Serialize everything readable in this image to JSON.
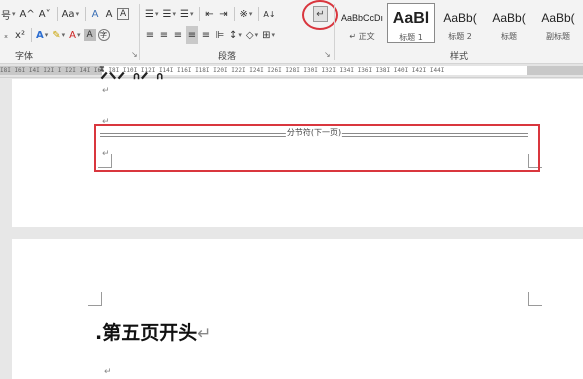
{
  "ribbon": {
    "font_row1": [
      "号",
      "A^",
      "A˅",
      "Aa",
      "A",
      "A"
    ],
    "font_row2": [
      "x²",
      "A",
      "ab",
      "A",
      "A",
      "字"
    ],
    "para_row1": [
      "≡",
      "≡",
      "≡",
      "≡",
      "≡",
      "A"
    ],
    "para_row2": [
      "≡",
      "≡",
      "≡",
      "≡",
      "≡",
      "≡",
      "↕",
      "◇",
      "⊞"
    ],
    "show_marks_label": "↵",
    "group_font": "字体",
    "group_paragraph": "段落",
    "group_styles": "样式",
    "styles": [
      {
        "sample": "AaBbCcDı",
        "name": "↵ 正文"
      },
      {
        "sample": "AaBl",
        "name": "标题 1"
      },
      {
        "sample": "AaBb(",
        "name": "标题 2"
      },
      {
        "sample": "AaBb(",
        "name": "标题"
      },
      {
        "sample": "AaBb(",
        "name": "副标题"
      }
    ]
  },
  "ruler": {
    "ticks": "I8I I6I I4I I2I I I2I I4I I6I I8I I10I I12I I14I I16I I18I I20I I22I I24I I26I I28I I30I I32I I34I I36I I38I I40I I42I I44I"
  },
  "document": {
    "section_break_label": "分节符(下一页)",
    "heading_text": ".第五页开头",
    "para_mark": "↵"
  }
}
